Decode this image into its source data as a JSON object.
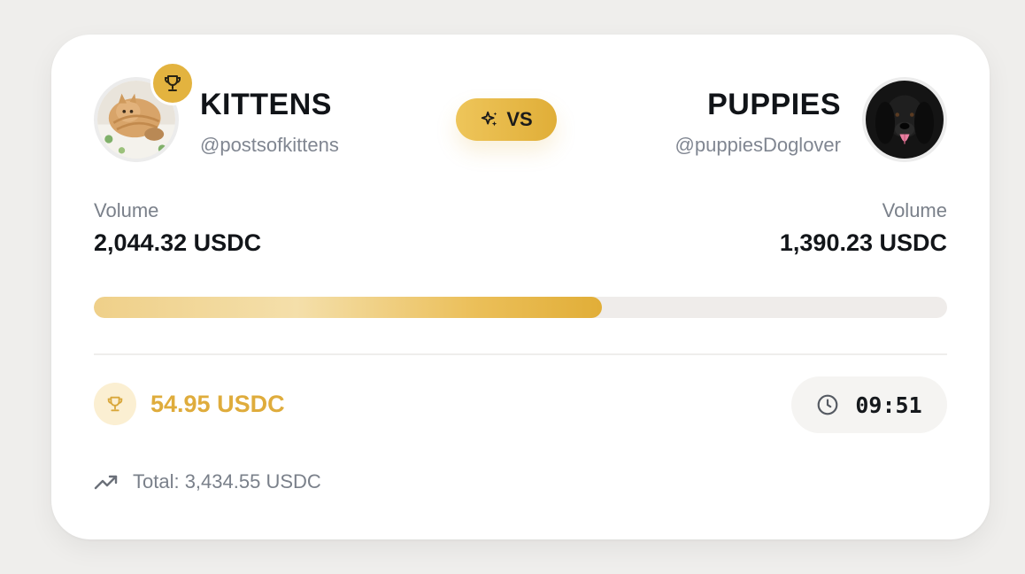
{
  "left_team": {
    "name": "KITTENS",
    "handle": "@postsofkittens",
    "volume_label": "Volume",
    "volume_value": "2,044.32 USDC"
  },
  "right_team": {
    "name": "PUPPIES",
    "handle": "@puppiesDoglover",
    "volume_label": "Volume",
    "volume_value": "1,390.23 USDC"
  },
  "vs_label": "VS",
  "progress_share_left": 0.595,
  "prize": {
    "value": "54.95 USDC",
    "icon": "trophy-icon"
  },
  "timer": {
    "value": "09:51",
    "icon": "clock-icon"
  },
  "total": {
    "text": "Total: 3,434.55 USDC",
    "icon": "trending-up-icon"
  },
  "colors": {
    "accent": "#e3b33f",
    "prize_text": "#dfac3c",
    "background": "#efeeec",
    "card": "#ffffff"
  }
}
